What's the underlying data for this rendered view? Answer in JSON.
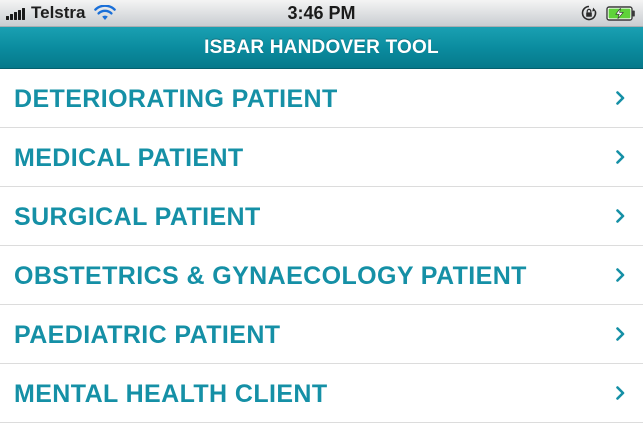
{
  "status_bar": {
    "carrier": "Telstra",
    "time": "3:46 PM",
    "signal_icon": "signal-bars-icon",
    "wifi_icon": "wifi-icon",
    "orientation_lock_icon": "orientation-lock-icon",
    "battery_icon": "battery-charging-icon",
    "battery_color": "#5fd23a"
  },
  "nav_bar": {
    "title": "ISBAR HANDOVER TOOL",
    "color": "#0b8c9f"
  },
  "menu": {
    "text_color": "#1590a6",
    "chevron_icon": "chevron-right-icon",
    "items": [
      {
        "label": "DETERIORATING PATIENT"
      },
      {
        "label": "MEDICAL PATIENT"
      },
      {
        "label": "SURGICAL PATIENT"
      },
      {
        "label": "OBSTETRICS & GYNAECOLOGY PATIENT"
      },
      {
        "label": "PAEDIATRIC PATIENT"
      },
      {
        "label": "MENTAL HEALTH CLIENT"
      }
    ]
  }
}
